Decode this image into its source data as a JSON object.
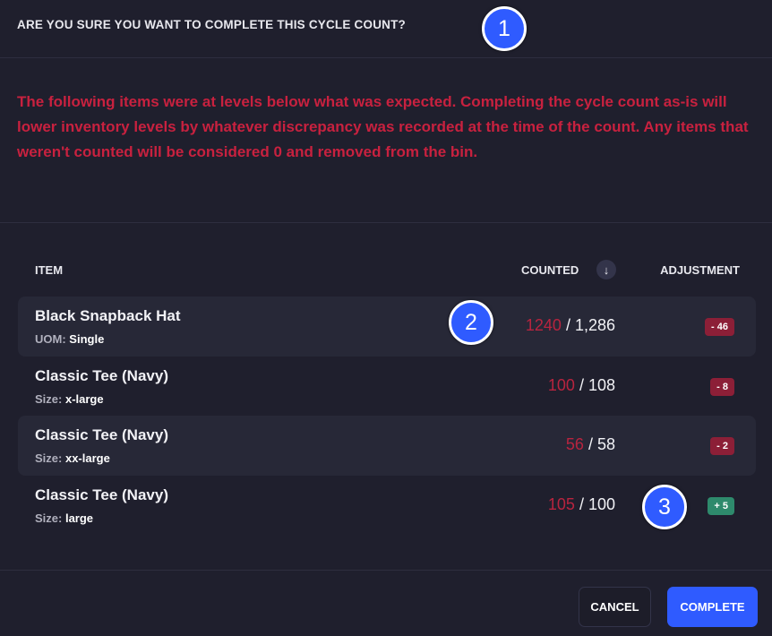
{
  "dialog": {
    "title": "ARE YOU SURE YOU WANT TO COMPLETE THIS CYCLE COUNT?",
    "warning": "The following items were at levels below what was expected. Completing the cycle count as-is will lower inventory levels by whatever discrepancy was recorded at the time of the count. Any items that weren't counted will be considered 0 and removed from the bin."
  },
  "table": {
    "columns": {
      "item": "ITEM",
      "counted": "COUNTED",
      "sort_icon": "arrow-down-icon",
      "adjustment": "ADJUSTMENT"
    },
    "rows": [
      {
        "name": "Black Snapback Hat",
        "attr_label": "UOM:",
        "attr_value": "Single",
        "counted": "1240",
        "expected": "/ 1,286",
        "adjustment": "-  46",
        "type": "negative"
      },
      {
        "name": "Classic Tee (Navy)",
        "attr_label": "Size:",
        "attr_value": "x-large",
        "counted": "100",
        "expected": "/ 108",
        "adjustment": "- 8",
        "type": "negative"
      },
      {
        "name": "Classic Tee (Navy)",
        "attr_label": "Size:",
        "attr_value": "xx-large",
        "counted": "56",
        "expected": "/ 58",
        "adjustment": "- 2",
        "type": "negative"
      },
      {
        "name": "Classic Tee (Navy)",
        "attr_label": "Size:",
        "attr_value": "large",
        "counted": "105",
        "expected": "/ 100",
        "adjustment": "+ 5",
        "type": "positive"
      }
    ]
  },
  "footer": {
    "cancel_label": "CANCEL",
    "complete_label": "COMPLETE"
  },
  "markers": [
    "1",
    "2",
    "3"
  ],
  "colors": {
    "background": "#1f1f2d",
    "warning_text": "#c8213f",
    "primary": "#2f5bff",
    "negative_badge": "#8c1f37",
    "positive_badge": "#2e8a6c"
  }
}
